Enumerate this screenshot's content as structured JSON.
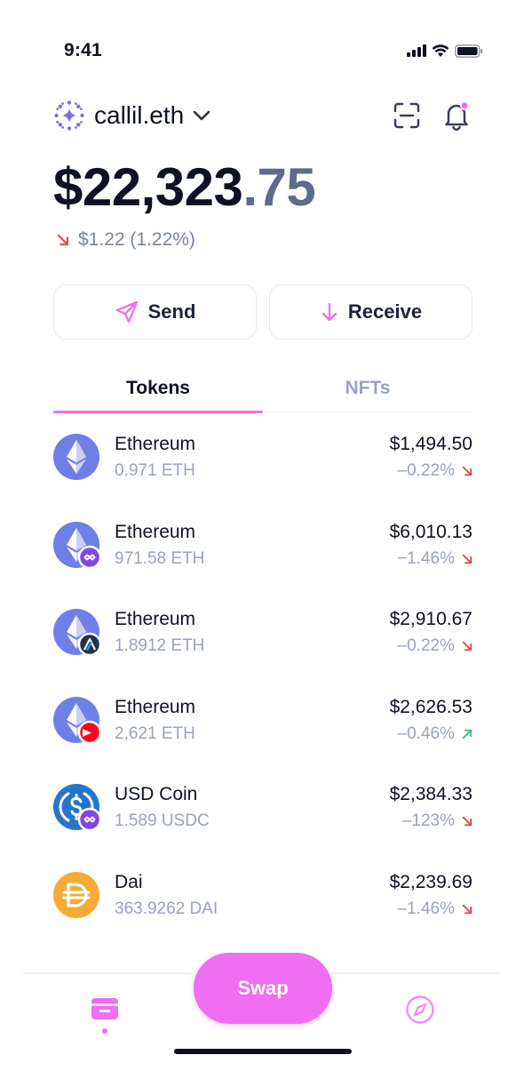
{
  "status_bar": {
    "time": "9:41"
  },
  "account": {
    "name": "callil.eth"
  },
  "balance": {
    "dollars": "$22,323",
    "cents": ".75"
  },
  "change": {
    "text": "$1.22 (1.22%)",
    "direction": "down"
  },
  "actions": {
    "send_label": "Send",
    "receive_label": "Receive"
  },
  "tabs": [
    {
      "label": "Tokens",
      "active": true
    },
    {
      "label": "NFTs",
      "active": false
    }
  ],
  "tokens": [
    {
      "name": "Ethereum",
      "amount": "0.971 ETH",
      "value": "$1,494.50",
      "change": "–0.22%",
      "direction": "down",
      "icon": "ethereum-icon"
    },
    {
      "name": "Ethereum",
      "amount": "971.58 ETH",
      "value": "$6,010.13",
      "change": "−1.46%",
      "direction": "down",
      "icon": "ethereum-polygon-icon"
    },
    {
      "name": "Ethereum",
      "amount": "1.8912 ETH",
      "value": "$2,910.67",
      "change": "–0.22%",
      "direction": "down",
      "icon": "ethereum-arbitrum-icon"
    },
    {
      "name": "Ethereum",
      "amount": "2,621 ETH",
      "value": "$2,626.53",
      "change": "–0.46%",
      "direction": "up",
      "icon": "ethereum-optimism-icon"
    },
    {
      "name": "USD Coin",
      "amount": "1.589 USDC",
      "value": "$2,384.33",
      "change": "–123%",
      "direction": "down",
      "icon": "usdc-polygon-icon"
    },
    {
      "name": "Dai",
      "amount": "363.9262 DAI",
      "value": "$2,239.69",
      "change": "–1.46%",
      "direction": "down",
      "icon": "dai-icon"
    }
  ],
  "bottom_nav": {
    "swap_label": "Swap"
  },
  "colors": {
    "accent": "#f06ef0",
    "down": "#e5484d",
    "up": "#33c57a",
    "eth": "#6f7fe8",
    "usdc": "#2775ca",
    "dai": "#f5ac37"
  }
}
